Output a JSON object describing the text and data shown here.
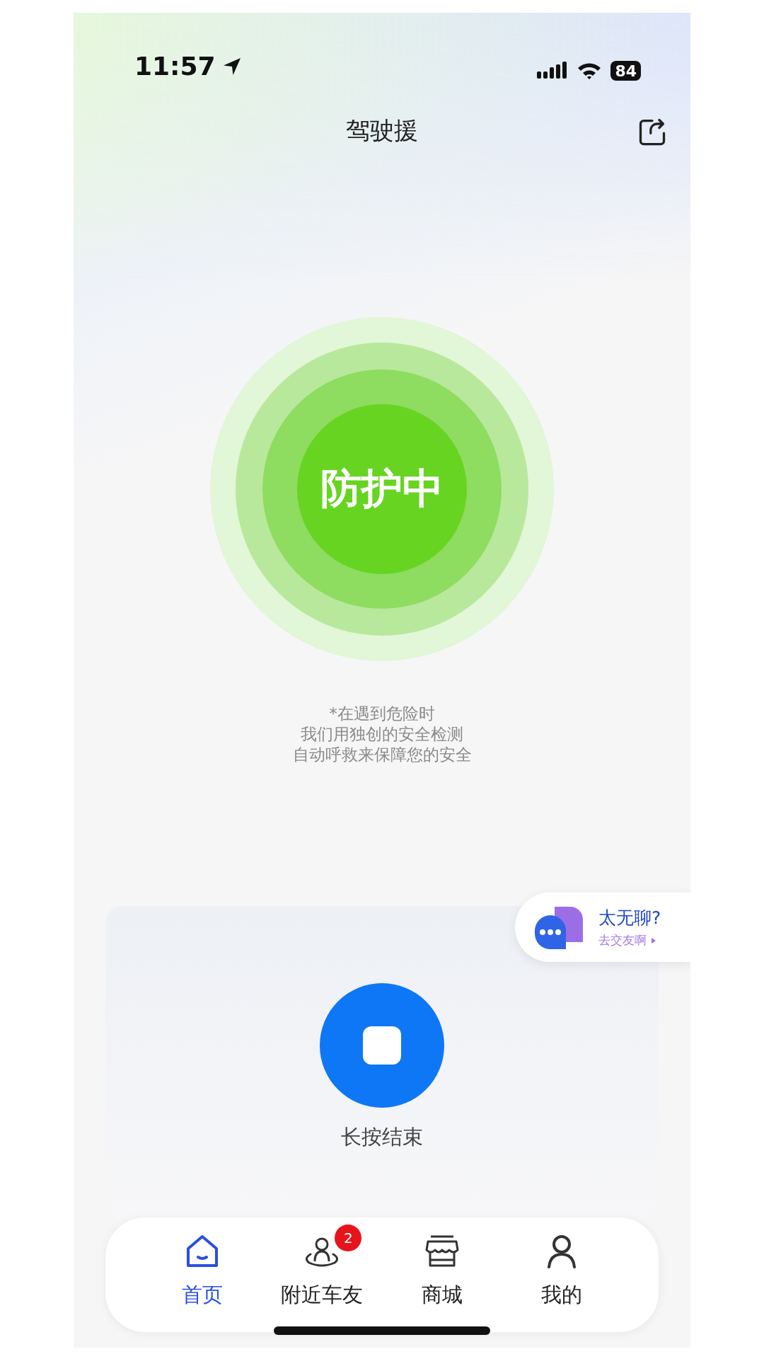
{
  "status_bar": {
    "time": "11:57",
    "battery": "84"
  },
  "header": {
    "title": "驾驶援"
  },
  "protection": {
    "status": "防护中"
  },
  "notice": [
    "*在遇到危险时",
    "我们用独创的安全检测",
    "自动呼救来保障您的安全"
  ],
  "chat_prompt": {
    "title": "太无聊?",
    "subtitle": "去交友啊"
  },
  "stop": {
    "label": "长按结束"
  },
  "tabs": [
    {
      "kind": "home",
      "label": "首页",
      "selected": true
    },
    {
      "kind": "nearby",
      "label": "附近车友",
      "selected": false,
      "badge": "2"
    },
    {
      "kind": "shop",
      "label": "商城",
      "selected": false
    },
    {
      "kind": "profile",
      "label": "我的",
      "selected": false
    }
  ]
}
